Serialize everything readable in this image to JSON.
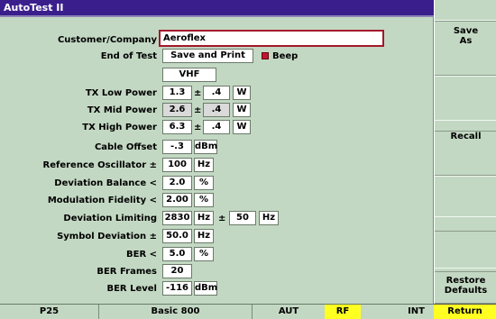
{
  "title": "AutoTest II",
  "softkeys": {
    "save_as": "Save\nAs",
    "recall": "Recall",
    "restore": "Restore\nDefaults",
    "return": "Return"
  },
  "form": {
    "customer_label": "Customer/Company",
    "customer_value": "Aeroflex",
    "end_of_test_label": "End of Test",
    "end_of_test_value": "Save and Print",
    "beep_label": "Beep",
    "band": "VHF",
    "tx_low_label": "TX Low Power",
    "tx_low_value": "1.3",
    "tx_low_tol": ".4",
    "tx_mid_label": "TX Mid Power",
    "tx_mid_value": "2.6",
    "tx_mid_tol": ".4",
    "tx_high_label": "TX High Power",
    "tx_high_value": "6.3",
    "tx_high_tol": ".4",
    "unit_w": "W",
    "cable_offset_label": "Cable Offset",
    "cable_offset_value": "-.3",
    "unit_dbm": "dBm",
    "ref_osc_label": "Reference Oscillator ±",
    "ref_osc_value": "100",
    "unit_hz": "Hz",
    "dev_balance_label": "Deviation Balance <",
    "dev_balance_value": "2.0",
    "unit_pct": "%",
    "mod_fidelity_label": "Modulation Fidelity <",
    "mod_fidelity_value": "2.00",
    "dev_limit_label": "Deviation Limiting",
    "dev_limit_value": "2830",
    "dev_limit_tol": "50",
    "sym_dev_label": "Symbol Deviation ±",
    "sym_dev_value": "50.0",
    "ber_label": "BER <",
    "ber_value": "5.0",
    "ber_frames_label": "BER Frames",
    "ber_frames_value": "20",
    "ber_level_label": "BER Level",
    "ber_level_value": "-116",
    "pm_symbol": "±"
  },
  "status": {
    "mode": "P25",
    "system": "Basic 800",
    "aut": "AUT",
    "rf": "RF",
    "int": "INT"
  },
  "colors": {
    "title_bg": "#3a1e8c",
    "rf": "#ffff22",
    "beep_indicator": "#c0143c"
  }
}
